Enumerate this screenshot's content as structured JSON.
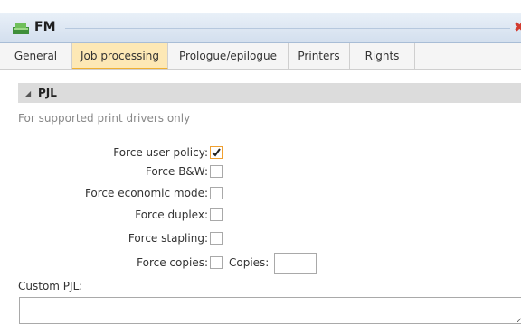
{
  "window": {
    "title": "FM",
    "close_glyph": "✖",
    "icon": "fm-app-icon"
  },
  "tabs": [
    {
      "label": "General",
      "active": false
    },
    {
      "label": "Job processing",
      "active": true
    },
    {
      "label": "Prologue/epilogue",
      "active": false
    },
    {
      "label": "Printers",
      "active": false
    },
    {
      "label": "Rights",
      "active": false
    }
  ],
  "section": {
    "title": "PJL",
    "expanded": true,
    "note": "For supported print drivers only"
  },
  "options": [
    {
      "label": "Force user policy:",
      "checked": true
    },
    {
      "label": "Force B&W:",
      "checked": false
    },
    {
      "label": "Force economic mode:",
      "checked": false
    },
    {
      "label": "Force duplex:",
      "checked": false
    },
    {
      "label": "Force stapling:",
      "checked": false
    },
    {
      "label": "Force copies:",
      "checked": false
    }
  ],
  "copies": {
    "label": "Copies:",
    "value": ""
  },
  "custom_pjl": {
    "label": "Custom PJL:",
    "value": ""
  },
  "colors": {
    "active_tab": "#fde8b5",
    "active_tab_border": "#f0b030",
    "checkbox_checked_border": "#f0a030",
    "close": "#d23b2f"
  }
}
